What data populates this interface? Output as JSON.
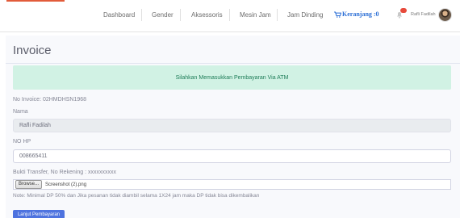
{
  "nav": {
    "items": [
      "Dashboard",
      "Gender",
      "Aksessoris",
      "Mesin Jam",
      "Jam Dinding"
    ],
    "cart_label": "Keranjang :0",
    "user_name": "Rafli Fadilah"
  },
  "page": {
    "title": "Invoice",
    "alert": "Silahkan Memasukkan Pembayaran Via ATM",
    "invoice_no": "No Invoice: 02HMDHSN1968",
    "nama_label": "Nama",
    "nama_value": "Rafli Fadilah",
    "hp_label": "NO HP",
    "hp_value": "008665411",
    "bukti_label": "Bukti Transfer, No Rekening : xxxxxxxxxx",
    "browse_label": "Browse...",
    "file_name": "Screenshot (2).png",
    "note": "Note: Minimal DP 50% dan Jika pesanan tidak diambil selama 1X24 jam maka DP tidak bisa dikembalikan",
    "submit_label": "Lanjut Pembayaran"
  },
  "colors": {
    "primary": "#4e73df",
    "alert_bg": "#d1f2e4",
    "alert_text": "#1e7d58",
    "cart_blue": "#2c6fd6",
    "badge_red": "#e74a3b"
  },
  "icons": [
    "cart-icon",
    "bell-icon",
    "avatar"
  ]
}
